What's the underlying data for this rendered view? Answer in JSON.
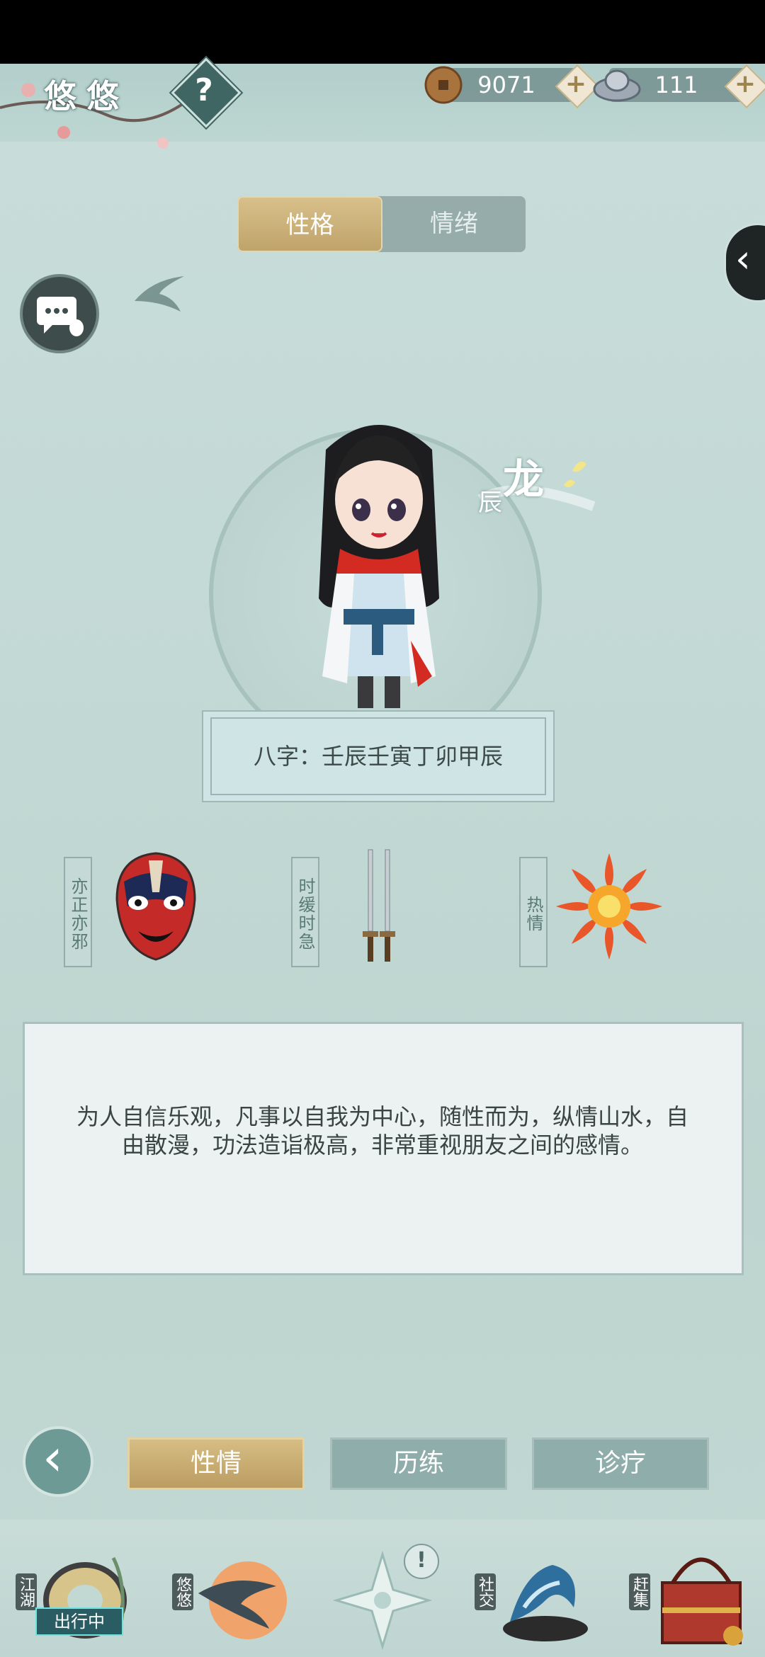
{
  "header": {
    "player_name": "悠悠",
    "help_label": "?",
    "copper": "9071",
    "silver": "111",
    "plus": "+"
  },
  "tabs": {
    "personality": "性格",
    "emotion": "情绪",
    "active": "personality"
  },
  "character": {
    "zodiac_big": "龙",
    "zodiac_small": "辰",
    "bazi": "八字：壬辰壬寅丁卯甲辰"
  },
  "traits": [
    {
      "label": "亦正亦邪",
      "icon": "opera-mask-icon"
    },
    {
      "label": "时缓时急",
      "icon": "twin-swords-icon"
    },
    {
      "label": "热情",
      "icon": "sun-flame-icon"
    }
  ],
  "description": "为人自信乐观，凡事以自我为中心，随性而为，纵情山水，自由散漫，功法造诣极高，非常重视朋友之间的感情。",
  "bottom_tabs": {
    "temperament": "性情",
    "experience": "历练",
    "treatment": "诊疗",
    "active": "temperament"
  },
  "bottom_nav": {
    "jianghu": "江湖",
    "jianghu_status": "出行中",
    "youyou": "悠悠",
    "social": "社交",
    "market": "赶集",
    "center_badge": "!"
  }
}
